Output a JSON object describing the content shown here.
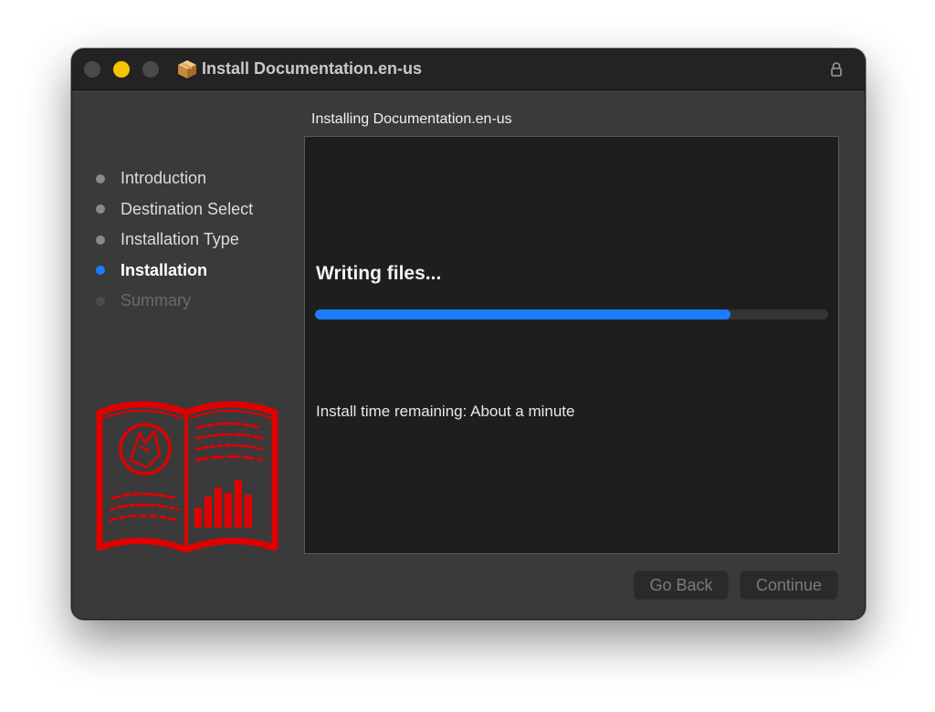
{
  "window": {
    "title": "Install Documentation.en-us"
  },
  "sidebar": {
    "steps": [
      {
        "label": "Introduction",
        "state": "done"
      },
      {
        "label": "Destination Select",
        "state": "done"
      },
      {
        "label": "Installation Type",
        "state": "done"
      },
      {
        "label": "Installation",
        "state": "active"
      },
      {
        "label": "Summary",
        "state": "pending"
      }
    ]
  },
  "main": {
    "heading": "Installing Documentation.en-us",
    "status": "Writing files...",
    "progress_fraction": 0.81,
    "time_remaining": "Install time remaining: About a minute"
  },
  "buttons": {
    "back_label": "Go Back",
    "continue_label": "Continue"
  },
  "colors": {
    "accent": "#1a7cff",
    "minimize": "#f5c400",
    "illustration": "#e00000"
  },
  "icons": {
    "title": "package-icon",
    "lock": "lock-icon",
    "illustration": "book-icon"
  }
}
